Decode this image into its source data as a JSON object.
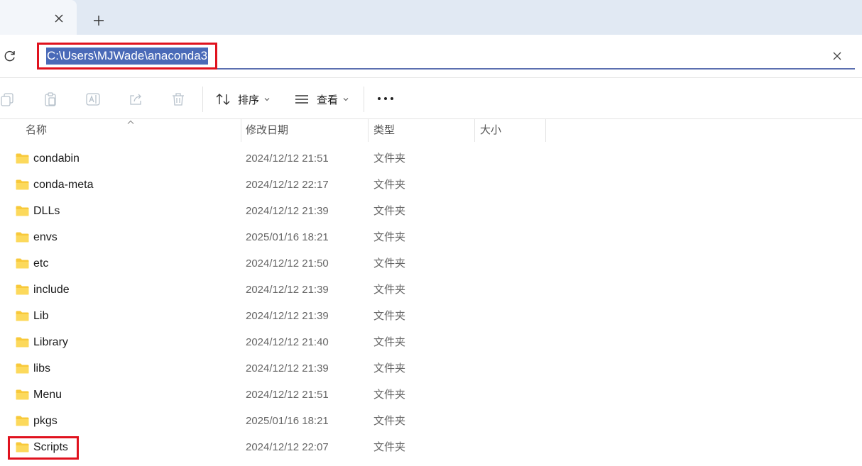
{
  "address": {
    "path": "C:\\Users\\MJWade\\anaconda3"
  },
  "toolbar": {
    "sort_label": "排序",
    "view_label": "查看"
  },
  "columns": {
    "name": "名称",
    "modified": "修改日期",
    "type": "类型",
    "size": "大小"
  },
  "files": [
    {
      "name": "condabin",
      "date": "2024/12/12 21:51",
      "type": "文件夹"
    },
    {
      "name": "conda-meta",
      "date": "2024/12/12 22:17",
      "type": "文件夹"
    },
    {
      "name": "DLLs",
      "date": "2024/12/12 21:39",
      "type": "文件夹"
    },
    {
      "name": "envs",
      "date": "2025/01/16 18:21",
      "type": "文件夹"
    },
    {
      "name": "etc",
      "date": "2024/12/12 21:50",
      "type": "文件夹"
    },
    {
      "name": "include",
      "date": "2024/12/12 21:39",
      "type": "文件夹"
    },
    {
      "name": "Lib",
      "date": "2024/12/12 21:39",
      "type": "文件夹"
    },
    {
      "name": "Library",
      "date": "2024/12/12 21:40",
      "type": "文件夹"
    },
    {
      "name": "libs",
      "date": "2024/12/12 21:39",
      "type": "文件夹"
    },
    {
      "name": "Menu",
      "date": "2024/12/12 21:51",
      "type": "文件夹"
    },
    {
      "name": "pkgs",
      "date": "2025/01/16 18:21",
      "type": "文件夹"
    },
    {
      "name": "Scripts",
      "date": "2024/12/12 22:07",
      "type": "文件夹"
    }
  ],
  "colors": {
    "highlight_box": "#e0121e",
    "selection": "#4a6ab8",
    "folder": "#f8c93a"
  }
}
